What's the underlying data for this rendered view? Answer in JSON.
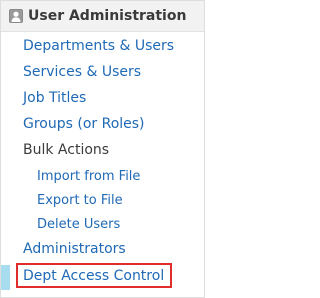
{
  "header": {
    "title": "User Administration",
    "icon": "user-silhouette-icon"
  },
  "menu": {
    "departments_users": "Departments & Users",
    "services_users": "Services & Users",
    "job_titles": "Job Titles",
    "groups_roles": "Groups (or Roles)",
    "bulk_actions": "Bulk Actions",
    "import_from_file": "Import from File",
    "export_to_file": "Export to File",
    "delete_users": "Delete Users",
    "administrators": "Administrators",
    "dept_access_control": "Dept Access Control"
  },
  "colors": {
    "link": "#1f69b5",
    "static_text": "#3c3c3c",
    "header_bg": "#f2f2f2",
    "active_marker": "#a8dcef",
    "highlight_border": "#e12c2c"
  }
}
